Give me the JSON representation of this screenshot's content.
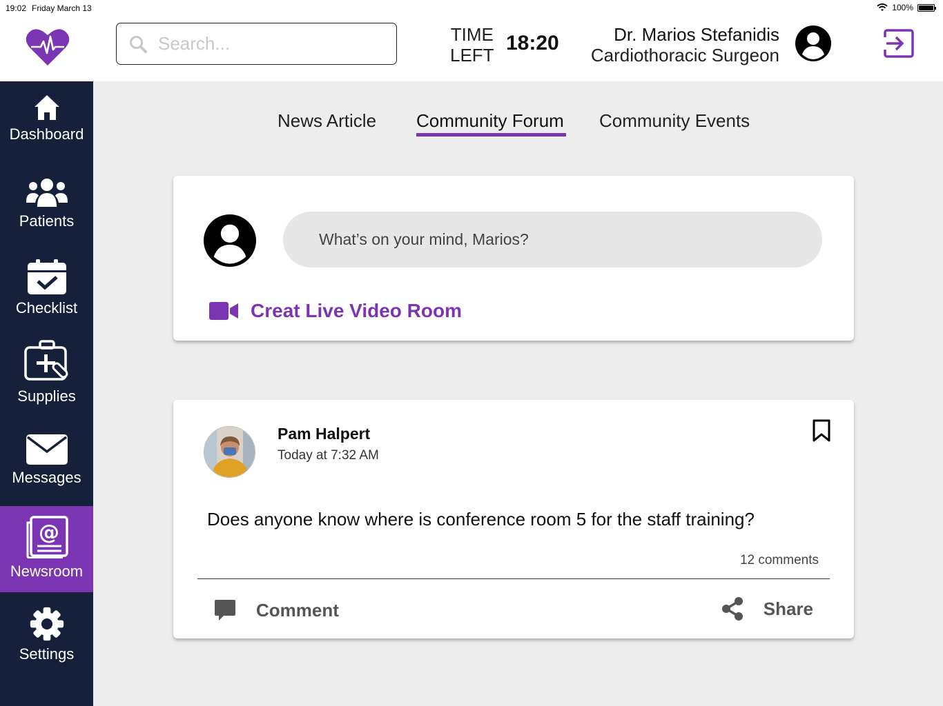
{
  "status_bar": {
    "time": "19:02",
    "date": "Friday March 13",
    "battery": "100%",
    "battery_level": 1.0
  },
  "header": {
    "search_placeholder": "Search...",
    "time_left_label_1": "TIME",
    "time_left_label_2": "LEFT",
    "time_left_value": "18:20",
    "user_name": "Dr. Marios Stefanidis",
    "user_role": "Cardiothoracic Surgeon"
  },
  "sidebar": {
    "items": [
      {
        "label": "Dashboard",
        "icon": "home-icon"
      },
      {
        "label": "Patients",
        "icon": "users-icon"
      },
      {
        "label": "Checklist",
        "icon": "calendar-check-icon"
      },
      {
        "label": "Supplies",
        "icon": "medkit-icon"
      },
      {
        "label": "Messages",
        "icon": "envelope-icon"
      },
      {
        "label": "Newsroom",
        "icon": "newsroom-icon",
        "active": true
      },
      {
        "label": "Settings",
        "icon": "gear-icon"
      }
    ]
  },
  "tabs": [
    {
      "label": "News Article"
    },
    {
      "label": "Community Forum",
      "active": true
    },
    {
      "label": "Community Events"
    }
  ],
  "composer": {
    "prompt": "What’s on your mind, Marios?",
    "live_label": "Creat Live Video Room"
  },
  "post": {
    "author": "Pam Halpert",
    "time": "Today at 7:32 AM",
    "text": "Does anyone know where is conference room 5 for the staff training?",
    "comments_count": "12 comments",
    "comment_label": "Comment",
    "share_label": "Share"
  },
  "colors": {
    "accent": "#7b35b3",
    "sidebar_bg": "#16203a",
    "page_bg": "#ededed"
  }
}
